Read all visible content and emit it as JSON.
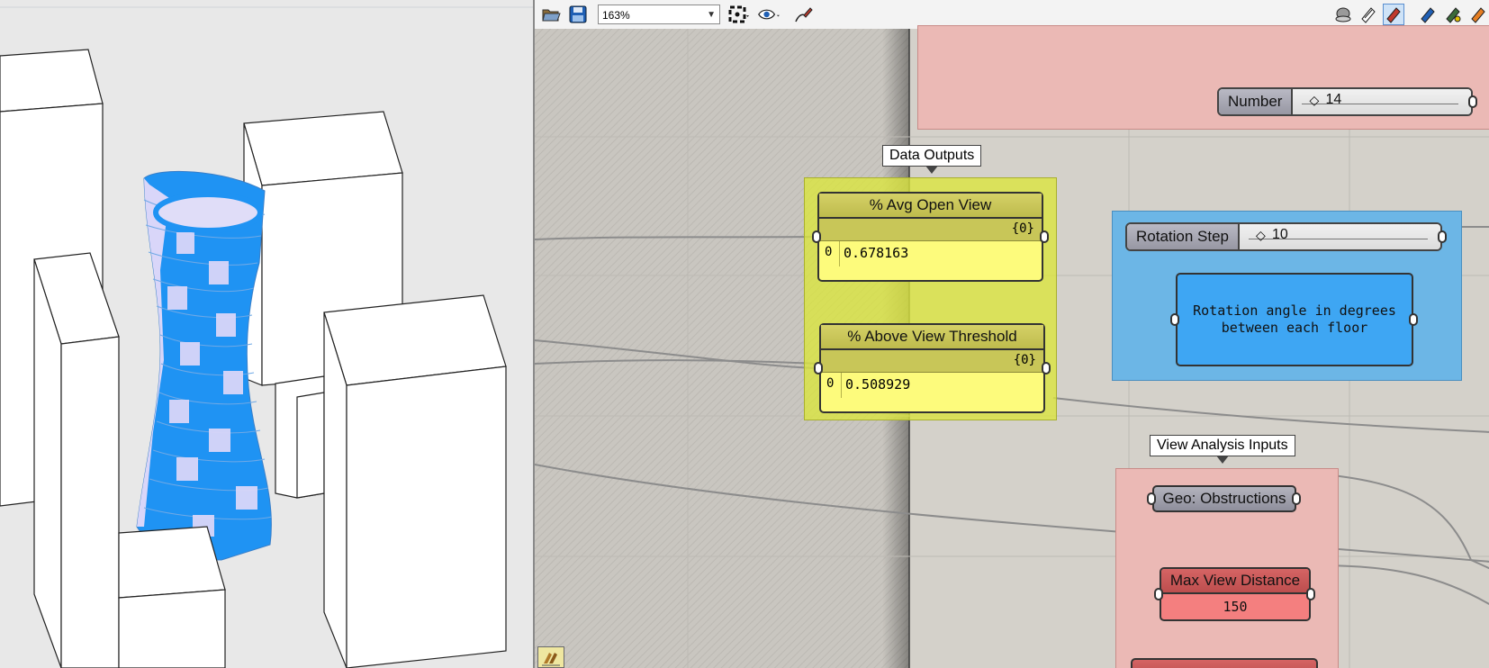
{
  "toolbar": {
    "zoom": "163%"
  },
  "canvas": {
    "slider_number": {
      "label": "Number",
      "value": "14"
    },
    "data_outputs_group": {
      "title": "Data Outputs"
    },
    "panel_avg_open_view": {
      "title": "% Avg Open View",
      "path": "{0}",
      "index": "0",
      "value": "0.678163"
    },
    "panel_above_threshold": {
      "title": "% Above View Threshold",
      "path": "{0}",
      "index": "0",
      "value": "0.508929"
    },
    "slider_rotation_step": {
      "label": "Rotation Step",
      "value": "10"
    },
    "rotation_note": {
      "text": "Rotation angle in degrees between each floor"
    },
    "view_analysis_group": {
      "title": "View Analysis Inputs"
    },
    "param_obstructions": {
      "label": "Geo: Obstructions"
    },
    "param_max_view_distance": {
      "label": "Max View Distance",
      "value": "150"
    }
  },
  "colors": {
    "group_pink": "#ebb9b5",
    "group_yellow": "#dbe64e",
    "group_blue": "#6cb6e6",
    "panel_yellow": "#fdfb7c",
    "note_blue": "#3ea6f3",
    "param_red": "#f47f7f",
    "tower_blue": "#1f93f3",
    "tower_lavender": "#d9d6f9"
  }
}
